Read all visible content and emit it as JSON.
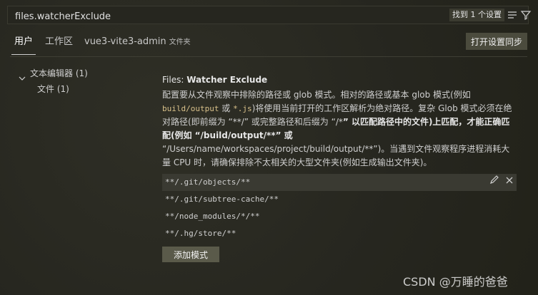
{
  "search": {
    "value": "files.watcherExclude",
    "result_badge": "找到 1 个设置"
  },
  "tabs": [
    {
      "label": "用户",
      "active": true
    },
    {
      "label": "工作区",
      "active": false
    },
    {
      "label": "vue3-vite3-admin",
      "suffix": "文件夹",
      "active": false
    }
  ],
  "sync_button": "打开设置同步",
  "tree": {
    "group": "文本编辑器 (1)",
    "child": "文件 (1)"
  },
  "setting": {
    "prefix": "Files: ",
    "name": "Watcher Exclude",
    "desc": {
      "p1": "配置要从文件观察中排除的路径或 glob 模式。相对的路径或基本 glob 模式(例如",
      "code1": "build/output",
      "p2": " 或 ",
      "code2": "*.js",
      "p3": ")将使用当前打开的工作区解析为绝对路径。复杂 Glob 模式必须在绝对路径(即前缀为 “**/” 或完整路径和后缀为 “/*",
      "strong1": "” 以匹配路径中的文件)上匹配，才能正确匹配(例如 “/build/output/**” 或",
      "p4": "“/Users/name/workspaces/project/build/output/**”)。当遇到文件观察程序进程消耗大量 CPU 时，请确保排除不太相关的大型文件夹(例如生成输出文件夹)。"
    }
  },
  "patterns": [
    "**/.git/objects/**",
    "**/.git/subtree-cache/**",
    "**/node_modules/*/**",
    "**/.hg/store/**"
  ],
  "add_button": "添加模式",
  "watermark": "CSDN @万睡的爸爸"
}
